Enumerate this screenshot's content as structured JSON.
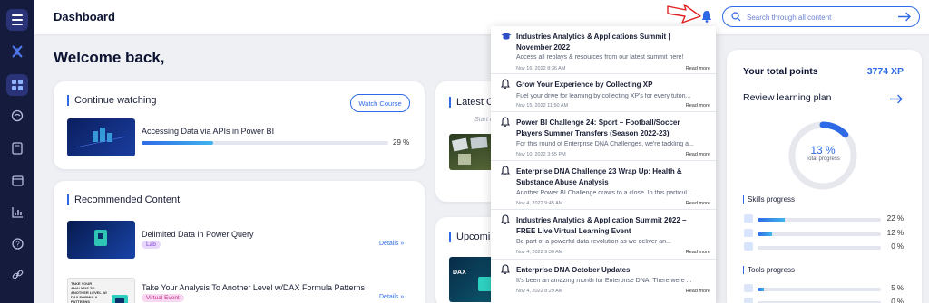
{
  "header": {
    "title": "Dashboard",
    "search_placeholder": "Search through all content"
  },
  "welcome": "Welcome back,",
  "continue_watching": {
    "title": "Continue watching",
    "button": "Watch Course",
    "item": {
      "title": "Accessing Data via APIs in Power BI",
      "progress": 29,
      "progress_label": "29 %"
    }
  },
  "recommended": {
    "title": "Recommended Content",
    "items": [
      {
        "title": "Delimited Data in Power Query",
        "badge": "Lab",
        "badge_color": "#e8d8fb",
        "details": "Details"
      },
      {
        "title": "Take Your Analysis To Another Level w/DAX Formula Patterns",
        "badge": "Virtual Event",
        "badge_color": "#f7d8f0",
        "details": "Details",
        "thumb_text": "TAKE YOUR ANALYSIS TO ANOTHER LEVEL W/ DAX FORMULA PATTERNS"
      }
    ]
  },
  "latest": {
    "title": "Latest Ch",
    "sub": "Start c"
  },
  "upcoming": {
    "title": "Upcomin",
    "thumb_text": "DAX"
  },
  "notifications": [
    {
      "icon": "graduation-cap-icon",
      "title": "Industries Analytics & Applications Summit | November 2022",
      "desc": "Access all replays & resources from our latest summit here!",
      "date": "Nov 16, 2022 8:36 AM",
      "more": "Read more"
    },
    {
      "icon": "bell-icon",
      "title": "Grow Your Experience by Collecting XP",
      "desc": "Fuel your drive for learning by collecting XP's for every tutori...",
      "date": "Nov 15, 2022 11:50 AM",
      "more": "Read more"
    },
    {
      "icon": "bell-icon",
      "title": "Power BI Challenge 24: Sport – Football/Soccer Players Summer Transfers (Season 2022-23)",
      "desc": "For this round of Enterprise DNA Challenges, we're tackling a...",
      "date": "Nov 10, 2022 3:55 PM",
      "more": "Read more"
    },
    {
      "icon": "bell-icon",
      "title": "Enterprise DNA Challenge 23 Wrap Up: Health & Substance Abuse Analysis",
      "desc": "Another Power BI Challenge draws to a close. In this particul...",
      "date": "Nov 4, 2022 9:45 AM",
      "more": "Read more"
    },
    {
      "icon": "bell-icon",
      "title": "Industries Analytics & Application Summit 2022 – FREE Live Virtual Learning Event",
      "desc": "Be part of a powerful data revolution as we deliver an...",
      "date": "Nov 4, 2022 9:30 AM",
      "more": "Read more"
    },
    {
      "icon": "bell-icon",
      "title": "Enterprise DNA October Updates",
      "desc": "It's been an amazing month for Enterprise DNA. There were ...",
      "date": "Nov 4, 2022 8:29 AM",
      "more": "Read more"
    }
  ],
  "points": {
    "label": "Your total points",
    "value": "3774 XP",
    "review": "Review learning plan",
    "total_pct": "13 %",
    "total_value": 13,
    "total_label": "Total progress"
  },
  "skills": {
    "title": "Skills progress",
    "items": [
      {
        "value": 22,
        "label": "22 %"
      },
      {
        "value": 12,
        "label": "12 %"
      },
      {
        "value": 0,
        "label": "0 %"
      }
    ]
  },
  "tools": {
    "title": "Tools progress",
    "items": [
      {
        "value": 5,
        "label": "5 %"
      },
      {
        "value": 0,
        "label": "0 %"
      }
    ]
  },
  "colors": {
    "accent": "#2f6ae6",
    "sidebar": "#151b3d",
    "annotation": "#e02020"
  }
}
